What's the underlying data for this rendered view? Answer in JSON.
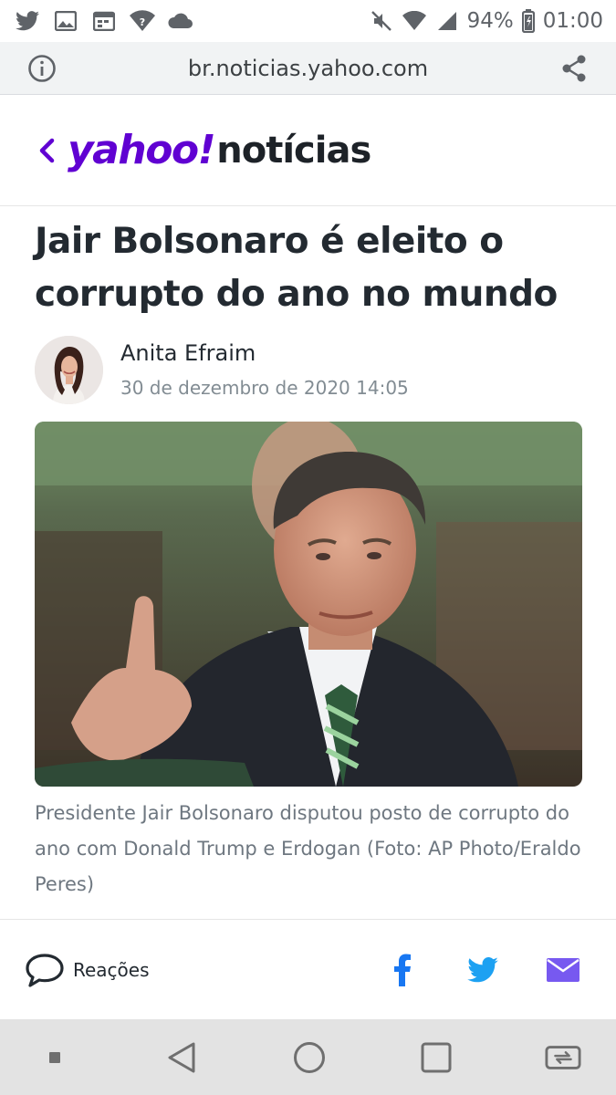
{
  "status_bar": {
    "left_icons": [
      "twitter-icon",
      "image-icon",
      "calendar-icon",
      "wifi-question-icon",
      "cloud-icon"
    ],
    "right_icons": [
      "mute-icon",
      "wifi-icon",
      "signal-icon"
    ],
    "battery": "94%",
    "time": "01:00"
  },
  "browser": {
    "url": "br.noticias.yahoo.com",
    "info_icon": "info-icon",
    "share_icon": "share-icon"
  },
  "site": {
    "back_icon": "chevron-left-icon",
    "logo_brand": "yahoo!",
    "logo_section": "notícias",
    "brand_color": "#6001d2"
  },
  "article": {
    "headline": "Jair Bolsonaro é eleito o corrupto do ano no mundo",
    "author": "Anita Efraim",
    "date": "30 de dezembro de 2020 14:05",
    "caption": "Presidente Jair Bolsonaro disputou posto de corrupto do ano com Donald Trump e Erdogan (Foto: AP Photo/Eraldo Peres)"
  },
  "engagement": {
    "reactions_label": "Reações",
    "reactions_icon": "speech-bubble-icon",
    "share_icons": [
      "facebook-icon",
      "twitter-icon",
      "mail-icon"
    ],
    "facebook_color": "#1877f2",
    "twitter_color": "#1da1f2",
    "mail_color": "#7759f0"
  },
  "nav_bar": {
    "buttons": [
      "menu-dot-icon",
      "back-triangle-icon",
      "home-circle-icon",
      "recents-square-icon",
      "screen-cast-icon"
    ]
  }
}
